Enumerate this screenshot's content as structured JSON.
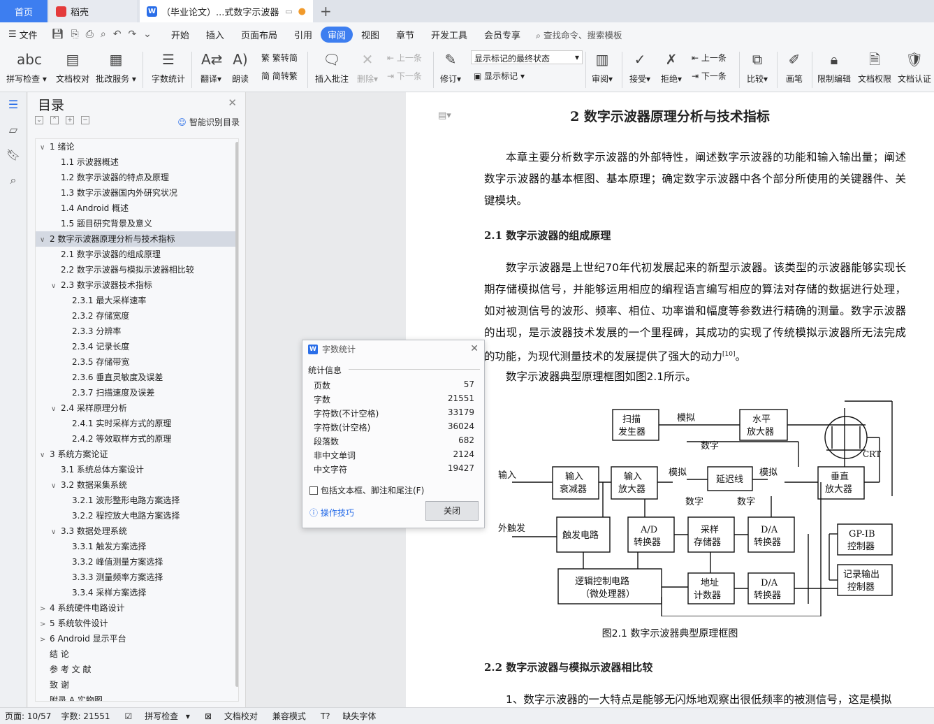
{
  "tabs": {
    "home": "首页",
    "wg": "稻壳",
    "doc": "（毕业论文）...式数字示波器",
    "add": "+"
  },
  "menu": {
    "file": "文件",
    "items": [
      "开始",
      "插入",
      "页面布局",
      "引用",
      "审阅",
      "视图",
      "章节",
      "开发工具",
      "会员专享"
    ],
    "search": "查找命令、搜索模板"
  },
  "ribbon": {
    "spell": "拼写检查",
    "proof": "文档校对",
    "annot_service": "批改服务",
    "wordcount": "字数统计",
    "translate": "翻译",
    "read": "朗读",
    "trad": "繁转简",
    "simp": "简转繁",
    "insert_comment": "插入批注",
    "delete": "删除",
    "prev": "上一条",
    "next": "下一条",
    "revise": "修订",
    "show_final": "显示标记的最终状态",
    "show_marks": "显示标记",
    "review": "审阅",
    "accept": "接受",
    "reject": "拒绝",
    "prev2": "上一条",
    "next2": "下一条",
    "compare": "比较",
    "pen": "画笔",
    "restrict": "限制编辑",
    "perm": "文档权限",
    "auth": "文档认证"
  },
  "toc": {
    "title": "目录",
    "smart": "智能识别目录",
    "items": [
      {
        "arrow": "v",
        "text": "1  绪论",
        "level": 0
      },
      {
        "arrow": "",
        "text": "1.1  示波器概述",
        "level": 1
      },
      {
        "arrow": "",
        "text": "1.2  数字示波器的特点及原理",
        "level": 1
      },
      {
        "arrow": "",
        "text": "1.3  数字示波器国内外研究状况",
        "level": 1
      },
      {
        "arrow": "",
        "text": "1.4 Android 概述",
        "level": 1
      },
      {
        "arrow": "",
        "text": "1.5  题目研究背景及意义",
        "level": 1
      },
      {
        "arrow": "v",
        "text": "2  数字示波器原理分析与技术指标",
        "level": 0,
        "sel": true
      },
      {
        "arrow": "",
        "text": "2.1  数字示波器的组成原理",
        "level": 1
      },
      {
        "arrow": "",
        "text": "2.2  数字示波器与模拟示波器相比较",
        "level": 1
      },
      {
        "arrow": "v",
        "text": "2.3  数字示波器技术指标",
        "level": 1
      },
      {
        "arrow": "",
        "text": "2.3.1  最大采样速率",
        "level": 2
      },
      {
        "arrow": "",
        "text": "2.3.2  存储宽度",
        "level": 2
      },
      {
        "arrow": "",
        "text": "2.3.3  分辨率",
        "level": 2
      },
      {
        "arrow": "",
        "text": "2.3.4  记录长度",
        "level": 2
      },
      {
        "arrow": "",
        "text": "2.3.5  存储带宽",
        "level": 2
      },
      {
        "arrow": "",
        "text": "2.3.6  垂直灵敏度及误差",
        "level": 2
      },
      {
        "arrow": "",
        "text": "2.3.7  扫描速度及误差",
        "level": 2
      },
      {
        "arrow": "v",
        "text": "2.4  采样原理分析",
        "level": 1
      },
      {
        "arrow": "",
        "text": "2.4.1  实时采样方式的原理",
        "level": 2
      },
      {
        "arrow": "",
        "text": "2.4.2  等效取样方式的原理",
        "level": 2
      },
      {
        "arrow": "v",
        "text": "3  系统方案论证",
        "level": 0
      },
      {
        "arrow": "",
        "text": "3.1  系统总体方案设计",
        "level": 1
      },
      {
        "arrow": "v",
        "text": "3.2  数据采集系统",
        "level": 1
      },
      {
        "arrow": "",
        "text": "3.2.1  波形整形电路方案选择",
        "level": 2
      },
      {
        "arrow": "",
        "text": "3.2.2  程控放大电路方案选择",
        "level": 2
      },
      {
        "arrow": "v",
        "text": "3.3  数据处理系统",
        "level": 1
      },
      {
        "arrow": "",
        "text": "3.3.1  触发方案选择",
        "level": 2
      },
      {
        "arrow": "",
        "text": "3.3.2  峰值测量方案选择",
        "level": 2
      },
      {
        "arrow": "",
        "text": "3.3.3  测量频率方案选择",
        "level": 2
      },
      {
        "arrow": "",
        "text": "3.3.4  采样方案选择",
        "level": 2
      },
      {
        "arrow": ">",
        "text": "4  系统硬件电路设计",
        "level": 0
      },
      {
        "arrow": ">",
        "text": "5  系统软件设计",
        "level": 0
      },
      {
        "arrow": ">",
        "text": "6 Android 显示平台",
        "level": 0
      },
      {
        "arrow": "",
        "text": "结   论",
        "level": 0
      },
      {
        "arrow": "",
        "text": "参   考   文   献",
        "level": 0
      },
      {
        "arrow": "",
        "text": "致   谢",
        "level": 0
      },
      {
        "arrow": "",
        "text": "附录 A   实物图",
        "level": 0
      }
    ]
  },
  "doc": {
    "title": "2  数字示波器原理分析与技术指标",
    "p1": "本章主要分析数字示波器的外部特性，阐述数字示波器的功能和输入输出量；阐述数字示波器的基本框图、基本原理；确定数字示波器中各个部分所使用的关键器件、关键模块。",
    "h21": "2.1  数字示波器的组成原理",
    "p2": "数字示波器是上世纪70年代初发展起来的新型示波器。该类型的示波器能够实现长期存储模拟信号，并能够运用相应的编程语言编写相应的算法对存储的数据进行处理，如对被测信号的波形、频率、相位、功率谱和幅度等参数进行精确的测量。数字示波器的出现，是示波器技术发展的一个里程碑，其成功的实现了传统模拟示波器所无法完成的功能，为现代测量技术的发展提供了强大的动力",
    "p2ref": "[10]",
    "p2end": "。",
    "p3": "数字示波器典型原理框图如图2.1所示。",
    "caption": "图2.1      数字示波器典型原理框图",
    "h22": "2.2  数字示波器与模拟示波器相比较",
    "p4": "1、数字示波器的一大特点是能够无闪烁地观察出很低频率的被测信号，这是模拟"
  },
  "diagram": {
    "scan": "扫描\n发生器",
    "hamp": "水平\n放大器",
    "crt": "CRT",
    "input": "输入",
    "att": "输入\n衰减器",
    "inamp": "输入\n放大器",
    "delay": "延迟线",
    "vamp": "垂直\n放大器",
    "analog1": "模拟",
    "digital1": "数字",
    "analog2": "模拟",
    "analog3": "模拟",
    "digital2": "数字",
    "digital3": "数字",
    "ext": "外触发",
    "trig": "触发电路",
    "adc": "A/D\n转换器",
    "sample": "采样\n存储器",
    "dac1": "D/A\n转换器",
    "gpib": "GP-IB\n控制器",
    "logic": "逻辑控制电路\n（微处理器）",
    "addr": "地址\n计数器",
    "dac2": "D/A\n转换器",
    "rec": "记录输出\n控制器"
  },
  "dialog": {
    "title": "字数统计",
    "section": "统计信息",
    "rows": [
      {
        "label": "页数",
        "value": "57"
      },
      {
        "label": "字数",
        "value": "21551"
      },
      {
        "label": "字符数(不计空格)",
        "value": "33179"
      },
      {
        "label": "字符数(计空格)",
        "value": "36024"
      },
      {
        "label": "段落数",
        "value": "682"
      },
      {
        "label": "非中文单词",
        "value": "2124"
      },
      {
        "label": "中文字符",
        "value": "19427"
      }
    ],
    "checkbox": "包括文本框、脚注和尾注(F)",
    "tips": "操作技巧",
    "close": "关闭"
  },
  "status": {
    "page": "页面: 10/57",
    "words": "字数: 21551",
    "spell": "拼写检查",
    "proof": "文档校对",
    "compat": "兼容模式",
    "missing": "缺失字体"
  }
}
